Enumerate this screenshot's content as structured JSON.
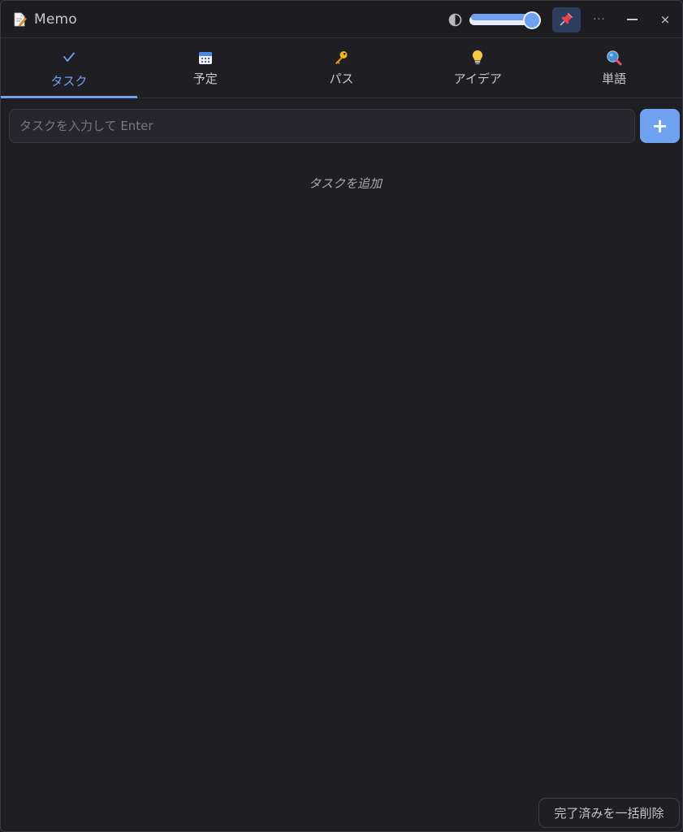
{
  "window": {
    "title": "Memo",
    "app_icon": "memo-icon",
    "opacity_level": 1.0,
    "pin_icon": "pushpin-icon",
    "more_glyph": "···",
    "minimize_glyph": "—",
    "close_glyph": "×"
  },
  "tabs": [
    {
      "label": "タスク",
      "icon": "checkmark-icon",
      "active": true
    },
    {
      "label": "予定",
      "icon": "calendar-icon",
      "active": false
    },
    {
      "label": "パス",
      "icon": "key-icon",
      "active": false
    },
    {
      "label": "アイデア",
      "icon": "lightbulb-icon",
      "active": false
    },
    {
      "label": "単語",
      "icon": "magnifier-icon",
      "active": false
    }
  ],
  "task_input": {
    "placeholder": "タスクを入力して Enter",
    "value": ""
  },
  "add_button": {
    "label": "+"
  },
  "empty_message": "タスクを追加",
  "footer": {
    "clear_done_label": "完了済みを一括削除"
  },
  "colors": {
    "accent": "#6ea1f0",
    "background": "#1f1e23",
    "pin_active_bg": "#2c3e5d"
  }
}
